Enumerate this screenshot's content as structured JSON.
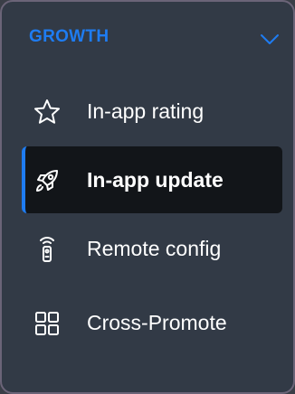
{
  "section": {
    "title": "GROWTH",
    "expand_icon": "chevron-down-icon",
    "accent_color": "#1e7cf2"
  },
  "nav": {
    "items": [
      {
        "label": "In-app rating",
        "icon": "star-icon",
        "active": false
      },
      {
        "label": "In-app update",
        "icon": "rocket-icon",
        "active": true
      },
      {
        "label": "Remote config",
        "icon": "remote-control-icon",
        "active": false
      },
      {
        "label": "Cross-Promote",
        "icon": "grid-icon",
        "active": false
      }
    ]
  }
}
